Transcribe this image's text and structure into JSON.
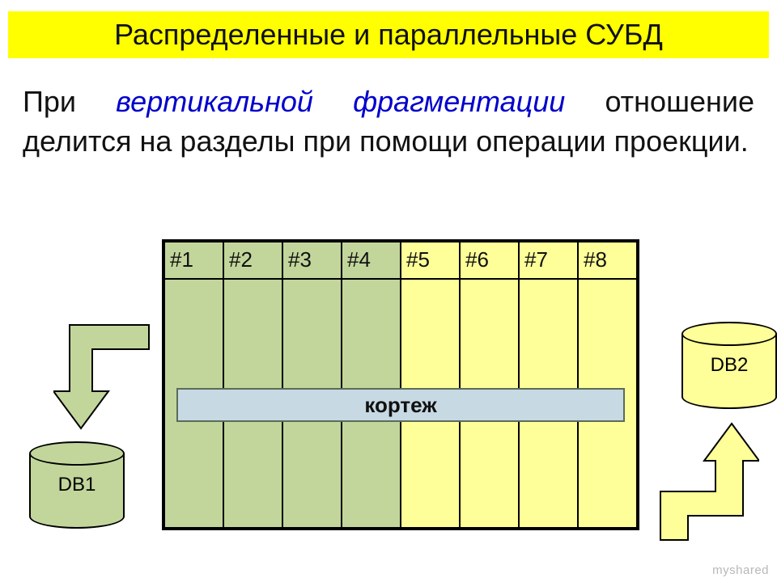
{
  "title": "Распределенные и параллельные СУБД",
  "paragraph": {
    "pre": "При ",
    "em": "вертикальной фрагментации",
    "post": " отношение делится на разделы при помощи операции проекции."
  },
  "columns": [
    "#1",
    "#2",
    "#3",
    "#4",
    "#5",
    "#6",
    "#7",
    "#8"
  ],
  "tuple_label": "кортеж",
  "db1_label": "DB1",
  "db2_label": "DB2",
  "watermark": "myshared",
  "colors": {
    "title_bg": "#ffff00",
    "green": "#c2d69b",
    "yellow": "#ffff99",
    "tuple_bg": "#c7d9e3",
    "accent_text": "#0000cc"
  },
  "chart_data": {
    "type": "table",
    "description": "Relation split by vertical fragmentation (projection) into two column groups stored in separate databases.",
    "columns": [
      "#1",
      "#2",
      "#3",
      "#4",
      "#5",
      "#6",
      "#7",
      "#8"
    ],
    "fragments": [
      {
        "name": "DB1",
        "columns": [
          "#1",
          "#2",
          "#3",
          "#4"
        ],
        "color": "#c2d69b"
      },
      {
        "name": "DB2",
        "columns": [
          "#5",
          "#6",
          "#7",
          "#8"
        ],
        "color": "#ffff99"
      }
    ],
    "row_label": "кортеж"
  }
}
